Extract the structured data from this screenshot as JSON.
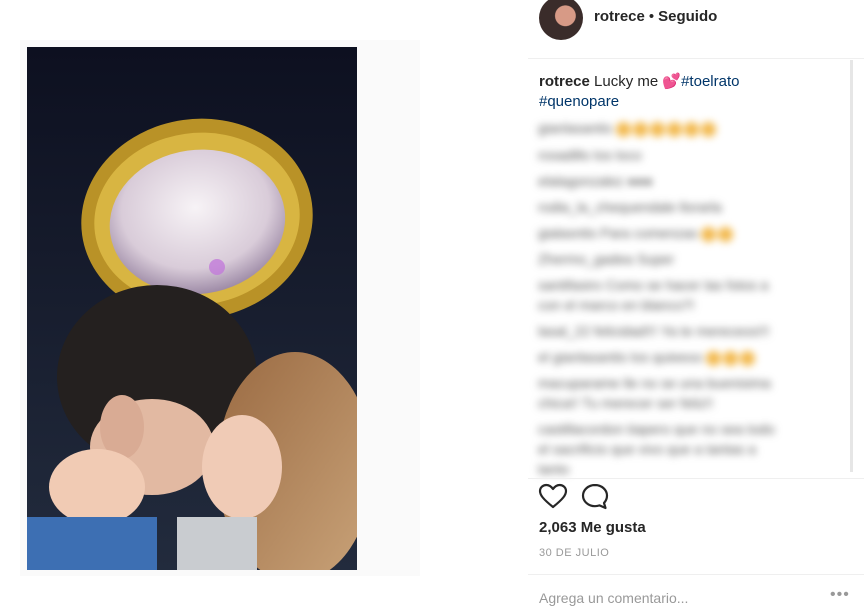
{
  "post": {
    "photo_alt": "Foto de rotrece",
    "photo_icon": "photo"
  },
  "header": {
    "username": "rotrece",
    "separator": "•",
    "follow_status": "Seguido",
    "avatar_icon": "avatar"
  },
  "caption": {
    "username": "rotrece",
    "text": "Lucky me",
    "emoji": "💕",
    "hashtags": [
      "#toelrato",
      "#quenopare"
    ]
  },
  "comments": [
    {
      "text": "gianlasantis",
      "emoji_count": 6
    },
    {
      "text": "rosadillo los loco",
      "emoji_count": 0
    },
    {
      "text": "elalagonzalez ●●●",
      "emoji_count": 0
    },
    {
      "text": "rodia_la_chequendale llorarla",
      "emoji_count": 0
    },
    {
      "text": "gialasntis Para comenzas",
      "emoji_count": 2
    },
    {
      "text": "Zhermo_gadea Super",
      "emoji_count": 0
    },
    {
      "text": "santifasiro Como se hacer las fotos a",
      "emoji_count": 0
    },
    {
      "text": "con el marco en blanco?!",
      "emoji_count": 0
    },
    {
      "text": "lasal_22 felicidad!!! Ya te mereceos!!!",
      "emoji_count": 0
    },
    {
      "text": "el gianlasantis los quieeoo",
      "emoji_count": 3
    },
    {
      "text": "macuparame lle no se una buenisima",
      "emoji_count": 0
    },
    {
      "text": "chica!! Tu merecer ser feliz!!",
      "emoji_count": 0
    },
    {
      "text": "castillacordon tiapero que no sea todo",
      "emoji_count": 0
    },
    {
      "text": "el sacrificio que vivo que a tantas a",
      "emoji_count": 0
    },
    {
      "text": "tanto",
      "emoji_count": 0
    }
  ],
  "actions": {
    "like_icon": "heart-outline",
    "comment_icon": "speech-bubble"
  },
  "likes": "2,063 Me gusta",
  "date": "30 DE JULIO",
  "add_comment": {
    "placeholder": "Agrega un comentario...",
    "more_label": "•••"
  },
  "colors": {
    "hashtag": "#003569",
    "text": "#262626",
    "muted": "#999999",
    "divider": "#efefef"
  }
}
